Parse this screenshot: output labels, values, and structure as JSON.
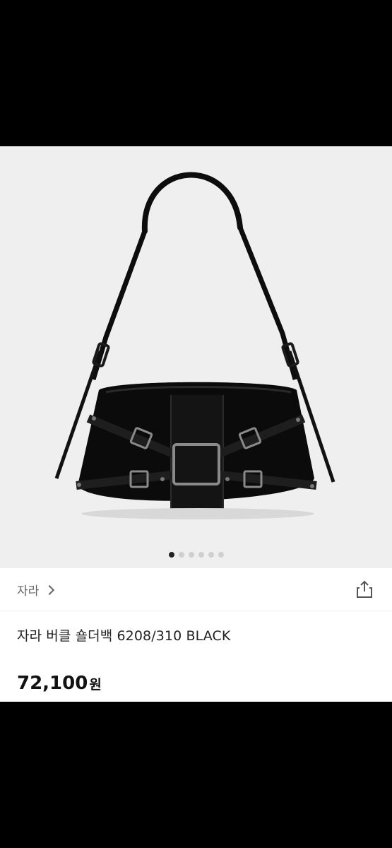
{
  "product": {
    "brand": "자라",
    "title": "자라 버클 숄더백 6208/310 BLACK",
    "price_amount": "72,100",
    "price_unit": "원",
    "image_name": "black-buckle-shoulder-bag-image"
  },
  "carousel": {
    "count": 6,
    "active_index": 0
  },
  "colors": {
    "image_bg": "#efefef",
    "dot_active": "#222222",
    "dot_inactive": "#cfcfcf"
  }
}
